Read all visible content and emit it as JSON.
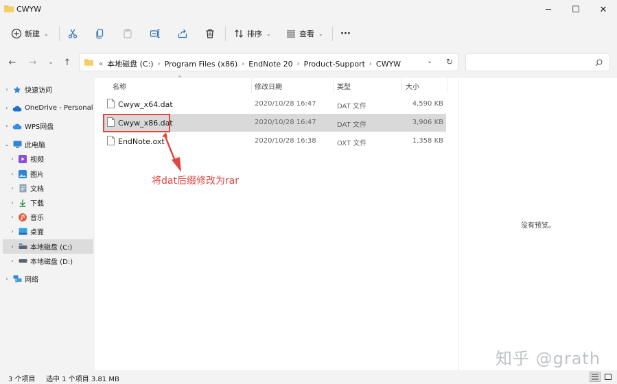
{
  "window": {
    "title": "CWYW",
    "minimize": "─",
    "maximize": "☐",
    "close": "✕"
  },
  "toolbar": {
    "new_label": "新建",
    "sort_label": "排序",
    "view_label": "查看",
    "more": "···"
  },
  "address": {
    "prefix": "«",
    "crumbs": [
      "本地磁盘 (C:)",
      "Program Files (x86)",
      "EndNote 20",
      "Product-Support",
      "CWYW"
    ]
  },
  "columns": {
    "name": "名称",
    "date": "修改日期",
    "type": "类型",
    "size": "大小"
  },
  "files": [
    {
      "name": "Cwyw_x64.dat",
      "date": "2020/10/28 16:47",
      "type": "DAT 文件",
      "size": "4,590 KB"
    },
    {
      "name": "Cwyw_x86.dat",
      "date": "2020/10/28 16:47",
      "type": "DAT 文件",
      "size": "3,906 KB"
    },
    {
      "name": "EndNote.oxt",
      "date": "2020/10/28 16:38",
      "type": "OXT 文件",
      "size": "1,358 KB"
    }
  ],
  "sidebar": {
    "items": [
      {
        "label": "快速访问",
        "icon": "star-icon"
      },
      {
        "label": "OneDrive - Personal",
        "icon": "cloud-icon"
      },
      {
        "label": "WPS网盘",
        "icon": "cloud-icon"
      },
      {
        "label": "此电脑",
        "icon": "computer-icon"
      },
      {
        "label": "视频",
        "icon": "video-icon"
      },
      {
        "label": "图片",
        "icon": "picture-icon"
      },
      {
        "label": "文档",
        "icon": "document-icon"
      },
      {
        "label": "下载",
        "icon": "download-icon"
      },
      {
        "label": "音乐",
        "icon": "music-icon"
      },
      {
        "label": "桌面",
        "icon": "desktop-icon"
      },
      {
        "label": "本地磁盘 (C:)",
        "icon": "drive-icon"
      },
      {
        "label": "本地磁盘 (D:)",
        "icon": "drive-icon"
      },
      {
        "label": "网络",
        "icon": "network-icon"
      }
    ]
  },
  "preview": {
    "empty_text": "没有预览。"
  },
  "annotation": {
    "text": "将dat后缀修改为rar",
    "color": "#e2453e"
  },
  "status": {
    "item_count": "3 个项目",
    "selection": "选中 1 个项目  3.81 MB"
  },
  "watermark": "知乎 @grath",
  "colors": {
    "accent": "#0067c0",
    "selection": "#d9d9d9",
    "annotation": "#e2453e",
    "folder": "#f2c04e"
  }
}
